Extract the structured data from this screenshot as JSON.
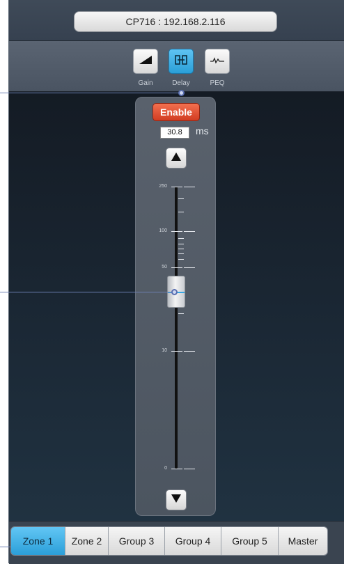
{
  "device": {
    "title": "CP716 : 192.168.2.116"
  },
  "modes": [
    {
      "label": "Gain",
      "icon": "gain-icon",
      "active": false
    },
    {
      "label": "Delay",
      "icon": "delay-icon",
      "active": true
    },
    {
      "label": "PEQ",
      "icon": "peq-icon",
      "active": false
    }
  ],
  "delay": {
    "enable_label": "Enable",
    "value": "30.8",
    "unit": "ms",
    "scale": [
      "250",
      "100",
      "50",
      "10",
      "0"
    ],
    "up_icon": "triangle-up-icon",
    "down_icon": "triangle-down-icon"
  },
  "tabs": [
    {
      "label": "Zone 1",
      "active": true
    },
    {
      "label": "Zone 2",
      "active": false
    },
    {
      "label": "Group 3",
      "active": false
    },
    {
      "label": "Group 4",
      "active": false
    },
    {
      "label": "Group 5",
      "active": false
    },
    {
      "label": "Master",
      "active": false
    }
  ],
  "colors": {
    "accent": "#2a9fd8",
    "enable": "#d23c22",
    "callout": "#6c7fb3"
  }
}
